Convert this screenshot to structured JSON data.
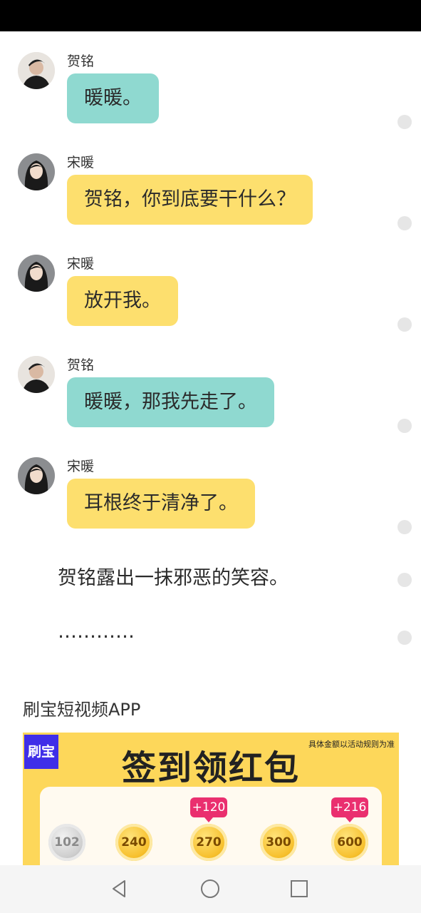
{
  "messages": [
    {
      "sender": "贺铭",
      "text": "暖暖。",
      "color": "teal",
      "avatar": "male-avatar"
    },
    {
      "sender": "宋暖",
      "text": "贺铭，你到底要干什么？",
      "color": "yellow",
      "avatar": "female-avatar"
    },
    {
      "sender": "宋暖",
      "text": "放开我。",
      "color": "yellow",
      "avatar": "female-avatar"
    },
    {
      "sender": "贺铭",
      "text": "暖暖，那我先走了。",
      "color": "teal",
      "avatar": "male-avatar"
    },
    {
      "sender": "宋暖",
      "text": "耳根终于清净了。",
      "color": "yellow",
      "avatar": "female-avatar"
    }
  ],
  "narration": [
    "贺铭露出一抹邪恶的笑容。",
    "…………"
  ],
  "ad": {
    "title": "刷宝短视频APP",
    "logo": "刷宝",
    "headline": "签到领红包",
    "disclaimer": "具体金额以活动规则为准",
    "coins": [
      "102",
      "240",
      "270",
      "300",
      "600"
    ],
    "bonuses": [
      "+120",
      "+216"
    ]
  },
  "colors": {
    "teal_bubble": "#8fd9d0",
    "yellow_bubble": "#fddf6e",
    "ad_background": "#fdd75a"
  },
  "navigation": {
    "back": "back-icon",
    "home": "home-icon",
    "recents": "recents-icon"
  }
}
